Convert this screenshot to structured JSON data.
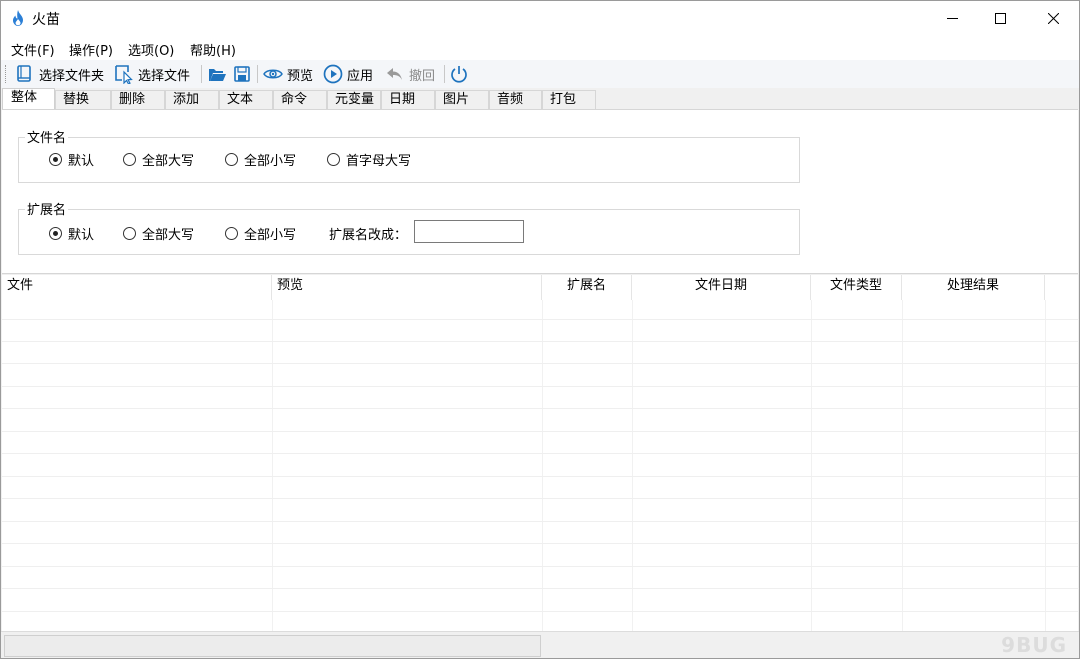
{
  "window": {
    "title": "火苗"
  },
  "menu": [
    "文件(F)",
    "操作(P)",
    "选项(O)",
    "帮助(H)"
  ],
  "toolbar": {
    "select_folder": "选择文件夹",
    "select_file": "选择文件",
    "preview": "预览",
    "apply": "应用",
    "undo": "撤回"
  },
  "tabs": [
    "整体",
    "替换",
    "删除",
    "添加",
    "文本",
    "命令",
    "元变量",
    "日期",
    "图片",
    "音频",
    "打包"
  ],
  "active_tab": "整体",
  "filename_group": {
    "legend": "文件名",
    "options": [
      "默认",
      "全部大写",
      "全部小写",
      "首字母大写"
    ],
    "selected": "默认"
  },
  "extension_group": {
    "legend": "扩展名",
    "options": [
      "默认",
      "全部大写",
      "全部小写"
    ],
    "selected": "默认",
    "change_label": "扩展名改成：",
    "change_value": ""
  },
  "list": {
    "columns": [
      "文件",
      "预览",
      "扩展名",
      "文件日期",
      "文件类型",
      "处理结果"
    ],
    "rows": []
  },
  "status": {
    "text": ""
  },
  "watermark": "9BUG",
  "colors": {
    "accent_blue": "#1e73be",
    "flame": "#2b7fd6"
  }
}
